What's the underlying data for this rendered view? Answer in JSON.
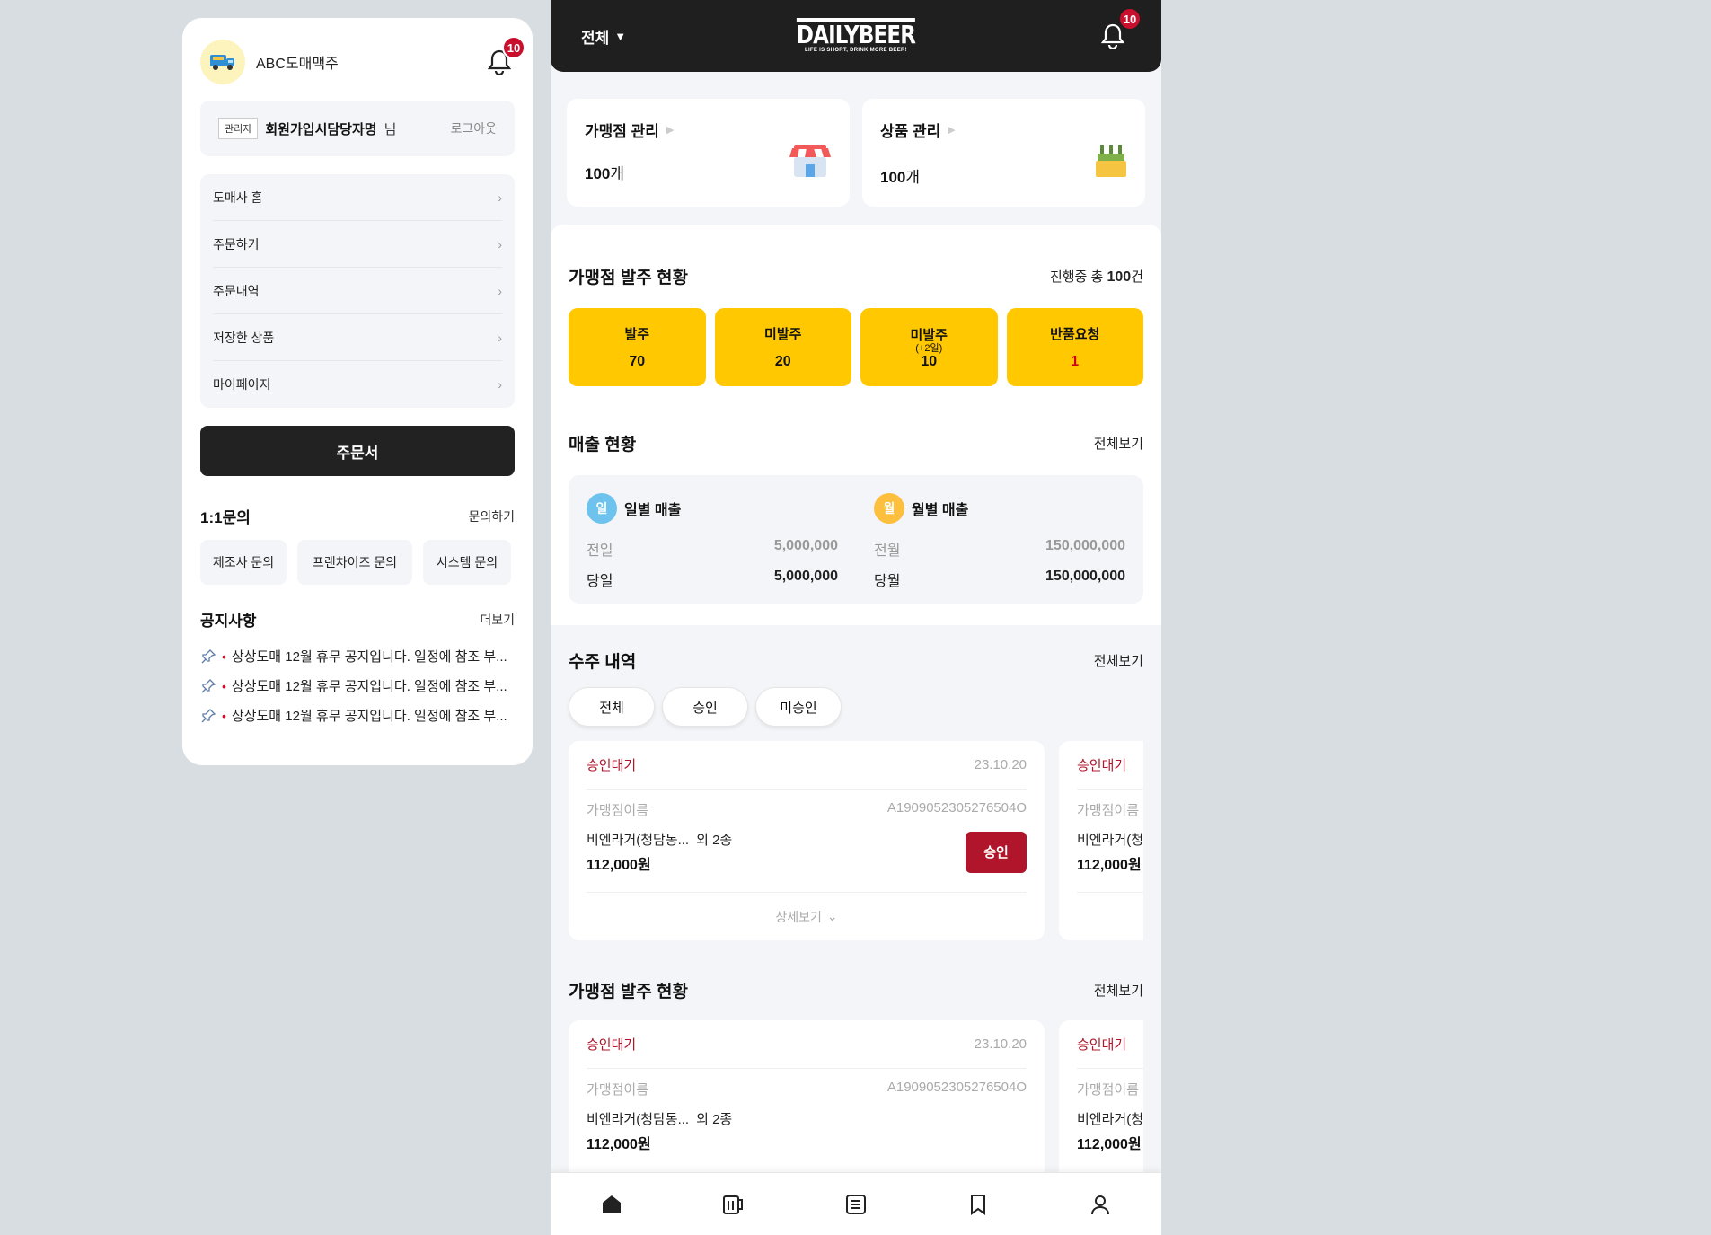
{
  "drawer": {
    "brand_name": "ABC도매맥주",
    "notification_count": "10",
    "user": {
      "role": "관리자",
      "name": "회원가입시담당자명",
      "suffix": "님",
      "logout": "로그아웃"
    },
    "menu": [
      {
        "label": "도매사 홈"
      },
      {
        "label": "주문하기"
      },
      {
        "label": "주문내역"
      },
      {
        "label": "저장한 상품"
      },
      {
        "label": "마이페이지"
      }
    ],
    "order_button": "주문서",
    "inquiry": {
      "title": "1:1문의",
      "link": "문의하기",
      "buttons": [
        "제조사 문의",
        "프랜차이즈 문의",
        "시스템 문의"
      ]
    },
    "notice": {
      "title": "공지사항",
      "link": "더보기",
      "items": [
        "상상도매 12월 휴무 공지입니다. 일정에 참조 부...",
        "상상도매 12월 휴무 공지입니다. 일정에 참조 부...",
        "상상도매 12월 휴무 공지입니다. 일정에 참조 부..."
      ]
    }
  },
  "header": {
    "selector": "전체",
    "logo_main": "DAILYBEER",
    "logo_sub": "LIFE IS SHORT, DRINK MORE BEER!",
    "notification_count": "10"
  },
  "stats": [
    {
      "title": "가맹점 관리",
      "value": "100",
      "unit": "개",
      "icon": "store-icon"
    },
    {
      "title": "상품 관리",
      "value": "100",
      "unit": "개",
      "icon": "beer-bottles-icon"
    }
  ],
  "order_status": {
    "title": "가맹점 발주 현황",
    "total_prefix": "진행중 총 ",
    "total_value": "100",
    "total_suffix": "건",
    "boxes": [
      {
        "label": "발주",
        "sub": "",
        "value": "70"
      },
      {
        "label": "미발주",
        "sub": "",
        "value": "20"
      },
      {
        "label": "미발주",
        "sub": "(+2일)",
        "value": "10"
      },
      {
        "label": "반품요청",
        "sub": "",
        "value": "1"
      }
    ]
  },
  "sales": {
    "title": "매출 현황",
    "link": "전체보기",
    "daily": {
      "badge": "일",
      "label": "일별 매출",
      "prev_label": "전일",
      "prev_value": "5,000,000",
      "cur_label": "당일",
      "cur_value": "5,000,000"
    },
    "monthly": {
      "badge": "월",
      "label": "월별 매출",
      "prev_label": "전월",
      "prev_value": "150,000,000",
      "cur_label": "당월",
      "cur_value": "150,000,000"
    }
  },
  "received_orders": {
    "title": "수주 내역",
    "link": "전체보기",
    "filters": [
      "전체",
      "승인",
      "미승인"
    ],
    "card": {
      "status": "승인대기",
      "date": "23.10.20",
      "store_label": "가맹점이름",
      "order_no": "A1909052305276504O",
      "product": "비엔라거(청담동...",
      "extra": "외 2종",
      "price": "112,000원",
      "approve": "승인",
      "more": "상세보기"
    },
    "card2": {
      "status": "승인대기",
      "store_label": "가맹점이름",
      "product": "비엔라거(청",
      "price": "112,000원"
    }
  },
  "store_orders": {
    "title": "가맹점 발주 현황",
    "link": "전체보기",
    "card": {
      "status": "승인대기",
      "date": "23.10.20",
      "store_label": "가맹점이름",
      "order_no": "A1909052305276504O",
      "product": "비엔라거(청담동...",
      "extra": "외 2종",
      "price": "112,000원"
    },
    "card2": {
      "status": "승인대기",
      "store_label": "가맹점이름",
      "product": "비엔라거(청",
      "price": "112,000원"
    }
  },
  "bottom_nav": [
    "home-icon",
    "beer-mug-icon",
    "list-icon",
    "bookmark-icon",
    "user-icon"
  ],
  "colors": {
    "accent_yellow": "#ffc800",
    "accent_red": "#b0152b",
    "header_dark": "#1f1f1f"
  }
}
